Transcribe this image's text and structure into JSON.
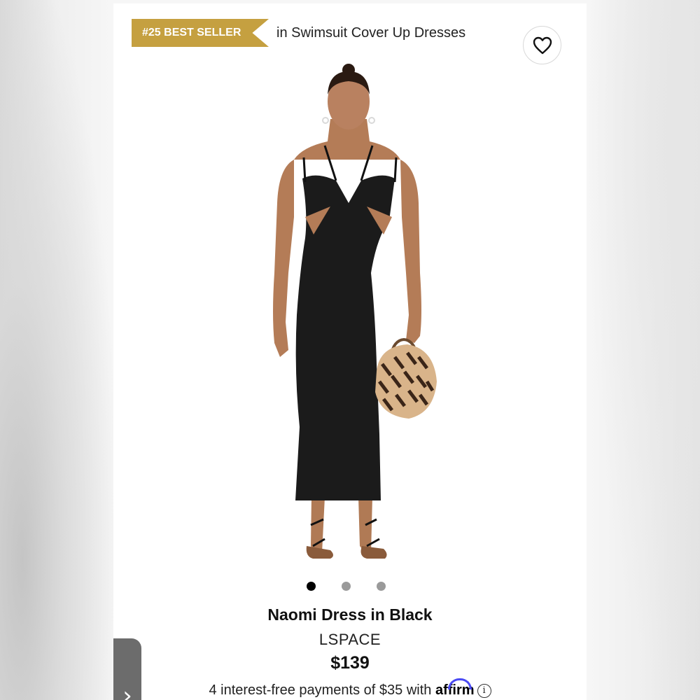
{
  "badge": {
    "rank_label": "#25 BEST SELLER",
    "category_text": "in Swimsuit Cover Up Dresses",
    "color": "#c5a040"
  },
  "favorite": {
    "icon": "heart-icon"
  },
  "gallery": {
    "image_count": 3,
    "active_index": 0
  },
  "product": {
    "name": "Naomi Dress in Black",
    "brand": "LSPACE",
    "price": "$139"
  },
  "financing": {
    "text": "4 interest-free payments of $35 with",
    "provider": "affirm",
    "info_icon": "info-icon"
  },
  "nav": {
    "next_icon": "chevron-right-icon",
    "next_glyph": "›"
  }
}
